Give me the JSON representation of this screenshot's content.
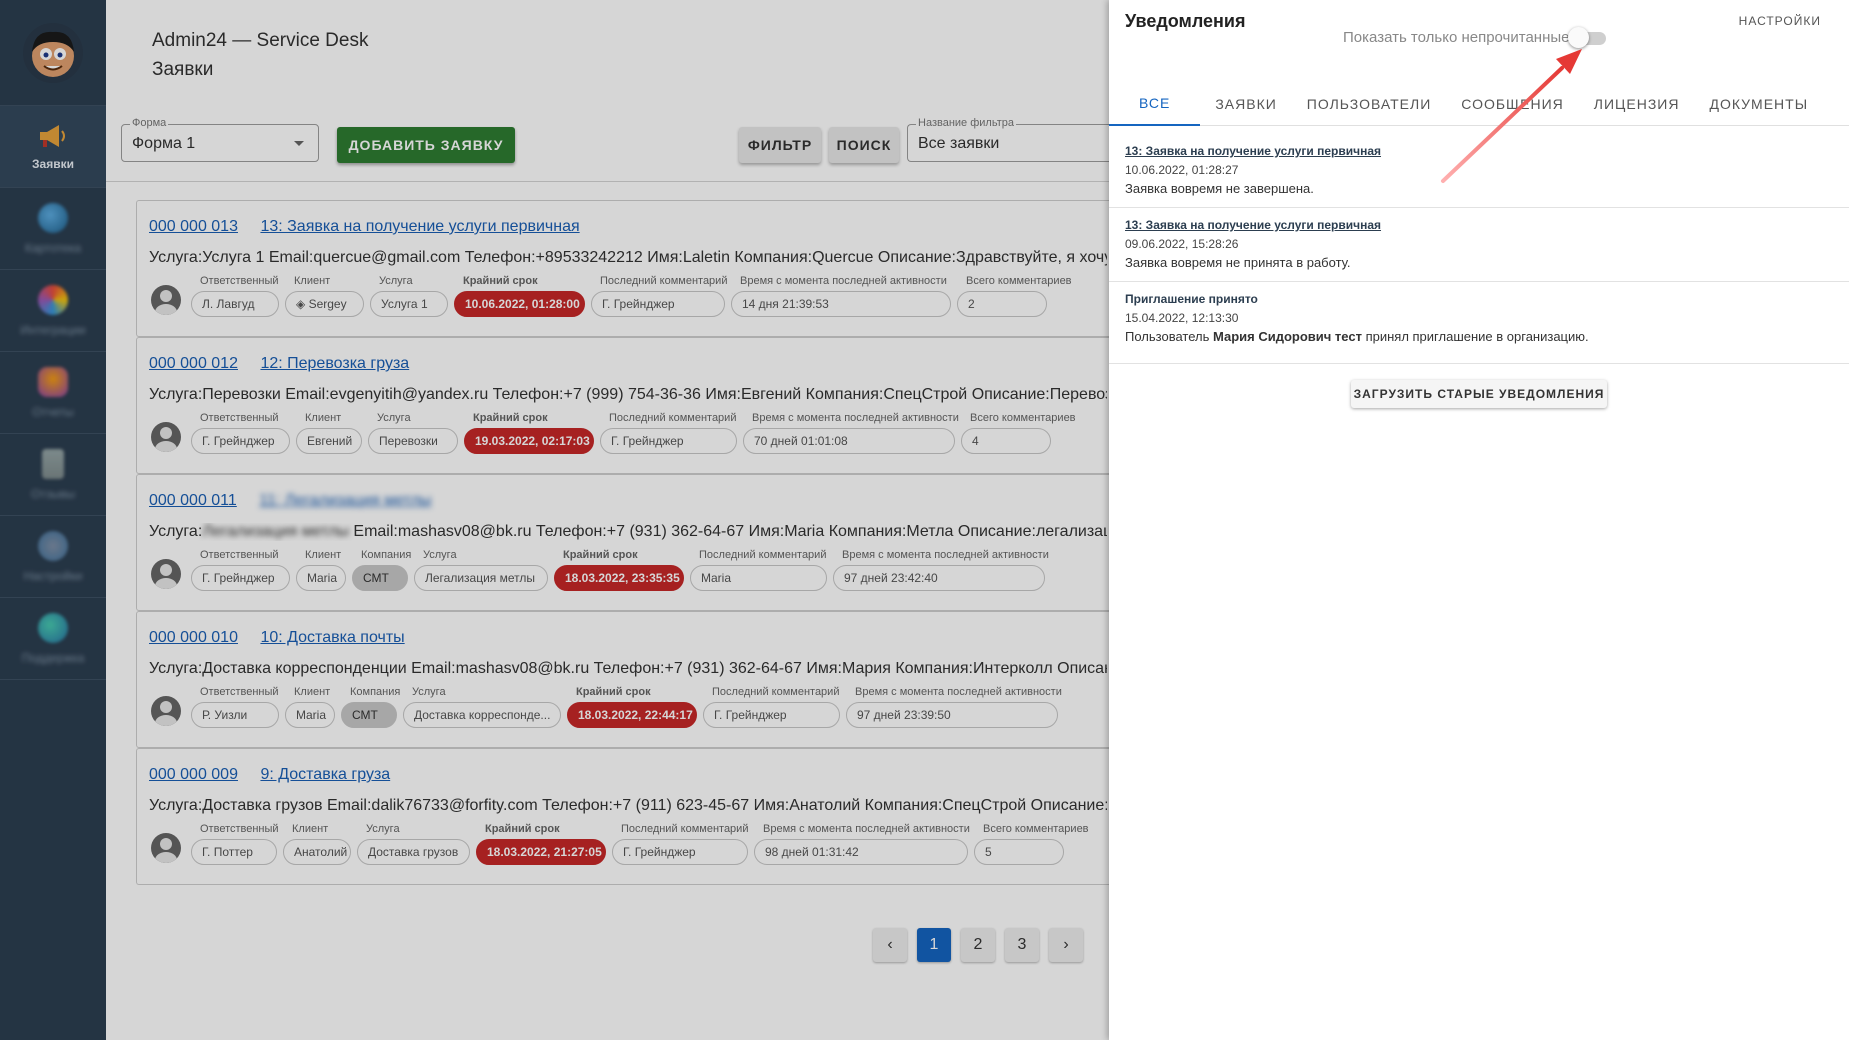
{
  "app": {
    "title": "Admin24 — Service Desk",
    "section": "Заявки"
  },
  "sidebar": {
    "items": [
      {
        "label": "Заявки",
        "icon": "megaphone-icon",
        "blurred": false
      },
      {
        "label": "Картотека",
        "icon": "blurred-icon",
        "blurred": true
      },
      {
        "label": "Интеграции",
        "icon": "blurred-icon",
        "blurred": true
      },
      {
        "label": "Отчеты",
        "icon": "blurred-icon",
        "blurred": true
      },
      {
        "label": "Отзывы",
        "icon": "blurred-icon",
        "blurred": true
      },
      {
        "label": "Настройки",
        "icon": "blurred-icon",
        "blurred": true
      },
      {
        "label": "Поддержка",
        "icon": "blurred-icon",
        "blurred": true
      }
    ]
  },
  "toolbar": {
    "form_label": "Форма",
    "form_value": "Форма 1",
    "add_label": "ДОБАВИТЬ ЗАЯВКУ",
    "filter_label": "ФИЛЬТР",
    "search_label": "ПОИСК",
    "filter_name_label": "Название фильтра",
    "filter_name_value": "Все заявки"
  },
  "tickets": [
    {
      "number": "000 000 013",
      "title": "13: Заявка на получение услуги первичная",
      "desc": "Услуга:Услуга 1 Email:quercue@gmail.com Телефон:+89533242212 Имя:Laletin Компания:Quercue Описание:Здравствуйте, я хочу получить услугу",
      "fields": [
        {
          "label": "Ответственный",
          "value": "Л. Лавгуд",
          "style": ""
        },
        {
          "label": "Клиент",
          "value": "◈ Sergey",
          "style": ""
        },
        {
          "label": "Услуга",
          "value": "Услуга 1",
          "style": ""
        },
        {
          "label": "Крайний срок",
          "value": "10.06.2022, 01:28:00",
          "style": "red"
        },
        {
          "label": "Последний комментарий",
          "value": "Г. Грейнджер",
          "style": ""
        },
        {
          "label": "Время с момента последней активности",
          "value": "14 дня 21:39:53",
          "style": ""
        },
        {
          "label": "Всего комментариев",
          "value": "2",
          "style": ""
        }
      ]
    },
    {
      "number": "000 000 012",
      "title": "12: Перевозка груза",
      "desc": "Услуга:Перевозки Email:evgenyitih@yandex.ru Телефон:+7 (999) 754-36-36 Имя:Евгений Компания:СпецСтрой Описание:Перевозка груза",
      "fields": [
        {
          "label": "Ответственный",
          "value": "Г. Грейнджер",
          "style": ""
        },
        {
          "label": "Клиент",
          "value": "Евгений",
          "style": ""
        },
        {
          "label": "Услуга",
          "value": "Перевозки",
          "style": ""
        },
        {
          "label": "Крайний срок",
          "value": "19.03.2022, 02:17:03",
          "style": "red"
        },
        {
          "label": "Последний комментарий",
          "value": "Г. Грейнджер",
          "style": ""
        },
        {
          "label": "Время с момента последней активности",
          "value": "70 дней 01:01:08",
          "style": ""
        },
        {
          "label": "Всего комментариев",
          "value": "4",
          "style": ""
        }
      ]
    },
    {
      "number": "000 000 011",
      "title": "11: Легализация метлы",
      "title_blurred": true,
      "desc_blur": "Легализация метлы",
      "desc_prefix": "Услуга:",
      "desc_suffix": " Email:mashasv08@bk.ru Телефон:+7 (931) 362-64-67 Имя:Maria Компания:Метла Описание:легализация метлы",
      "fields": [
        {
          "label": "Ответственный",
          "value": "Г. Грейнджер",
          "style": ""
        },
        {
          "label": "Клиент",
          "value": "Maria",
          "style": ""
        },
        {
          "label": "Компания",
          "value": "СМТ",
          "style": "grey"
        },
        {
          "label": "Услуга",
          "value": "Легализация метлы",
          "style": ""
        },
        {
          "label": "Крайний срок",
          "value": "18.03.2022, 23:35:35",
          "style": "red"
        },
        {
          "label": "Последний комментарий",
          "value": "Maria",
          "style": ""
        },
        {
          "label": "Время с момента последней активности",
          "value": "97 дней 23:42:40",
          "style": ""
        }
      ]
    },
    {
      "number": "000 000 010",
      "title": "10: Доставка почты",
      "desc": "Услуга:Доставка корреспонденции Email:mashasv08@bk.ru Телефон:+7 (931) 362-64-67 Имя:Мария Компания:Интерколл Описание:Доставка",
      "fields": [
        {
          "label": "Ответственный",
          "value": "Р. Уизли",
          "style": ""
        },
        {
          "label": "Клиент",
          "value": "Maria",
          "style": ""
        },
        {
          "label": "Компания",
          "value": "СМТ",
          "style": "grey"
        },
        {
          "label": "Услуга",
          "value": "Доставка корреспонде...",
          "style": ""
        },
        {
          "label": "Крайний срок",
          "value": "18.03.2022, 22:44:17",
          "style": "red"
        },
        {
          "label": "Последний комментарий",
          "value": "Г. Грейнджер",
          "style": ""
        },
        {
          "label": "Время с момента последней активности",
          "value": "97 дней 23:39:50",
          "style": ""
        }
      ]
    },
    {
      "number": "000 000 009",
      "title": "9: Доставка груза",
      "desc": "Услуга:Доставка грузов Email:dalik76733@forfity.com Телефон:+7 (911) 623-45-67 Имя:Анатолий Компания:СпецСтрой Описание:Доставка",
      "fields": [
        {
          "label": "Ответственный",
          "value": "Г. Поттер",
          "style": ""
        },
        {
          "label": "Клиент",
          "value": "Анатолий",
          "style": ""
        },
        {
          "label": "Услуга",
          "value": "Доставка грузов",
          "style": ""
        },
        {
          "label": "Крайний срок",
          "value": "18.03.2022, 21:27:05",
          "style": "red"
        },
        {
          "label": "Последний комментарий",
          "value": "Г. Грейнджер",
          "style": ""
        },
        {
          "label": "Время с момента последней активности",
          "value": "98 дней 01:31:42",
          "style": ""
        },
        {
          "label": "Всего комментариев",
          "value": "5",
          "style": ""
        }
      ]
    }
  ],
  "pagination": {
    "pages": [
      "1",
      "2",
      "3"
    ],
    "current": "1",
    "prev": "‹",
    "next": "›"
  },
  "notifications": {
    "title": "Уведомления",
    "settings_label": "НАСТРОЙКИ",
    "unread_only_label": "Показать только непрочитанные",
    "unread_only": false,
    "tabs": [
      "ВСЕ",
      "ЗАЯВКИ",
      "ПОЛЬЗОВАТЕЛИ",
      "СООБЩЕНИЯ",
      "ЛИЦЕНЗИЯ",
      "ДОКУМЕНТЫ"
    ],
    "active_tab": "ВСЕ",
    "items": [
      {
        "title": "13: Заявка на получение услуги первичная",
        "link": true,
        "date": "10.06.2022, 01:28:27",
        "text": "Заявка вовремя не завершена."
      },
      {
        "title": "13: Заявка на получение услуги первичная",
        "link": true,
        "date": "09.06.2022, 15:28:26",
        "text": "Заявка вовремя не принята в работу."
      },
      {
        "title": "Приглашение принято",
        "link": false,
        "date": "15.04.2022, 12:13:30",
        "text_prefix": "Пользователь ",
        "text_bold": "Мария Сидорович тест",
        "text_suffix": " принял приглашение в организацию."
      }
    ],
    "load_more_label": "ЗАГРУЗИТЬ СТАРЫЕ УВЕДОМЛЕНИЯ"
  },
  "colors": {
    "sidebar": "#2c3e50",
    "accent": "#1565c0",
    "add_button": "#2e7d32",
    "deadline": "#c62828",
    "annotation_arrow": "#e53935"
  }
}
